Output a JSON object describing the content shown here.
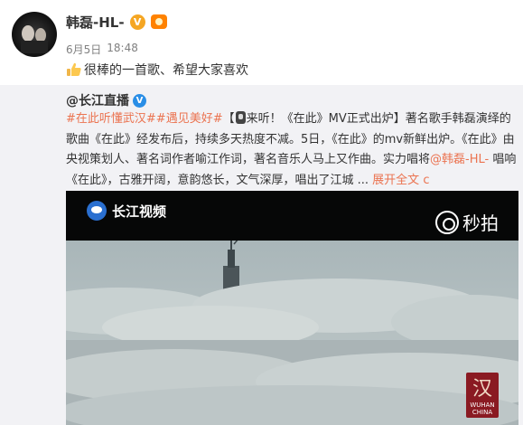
{
  "post": {
    "author": "韩磊-HL-",
    "badge_text": "V",
    "timestamp_date": "6月5日",
    "timestamp_time": "18:48",
    "text": "很棒的一首歌、希望大家喜欢"
  },
  "repost": {
    "author": "@长江直播",
    "badge_text": "V",
    "body": {
      "tag1": "#在此听懂武汉#",
      "tag2": "#遇见美好#",
      "bracket_open": "【",
      "title_part": "来听！《在此》MV正式出炉】著名歌手韩磊演绎的歌曲《在此》经发布后，持续多天热度不减。5日，《在此》的mv新鲜出炉。《在此》由央视策划人、著名词作者喻江作词，著名音乐人马上又作曲。实力唱将",
      "mention": "@韩磊-HL-",
      "after_mention": " 唱响《在此》，古雅开阔，意韵悠长，文气深厚，唱出了江城 ...",
      "expand_link": "展开全文",
      "expand_arrow": "c"
    }
  },
  "video": {
    "channel_logo": "长江视频",
    "watermark": "秒拍",
    "corner_glyph": "汉",
    "corner_text_1": "WUHAN",
    "corner_text_2": "CHINA"
  }
}
